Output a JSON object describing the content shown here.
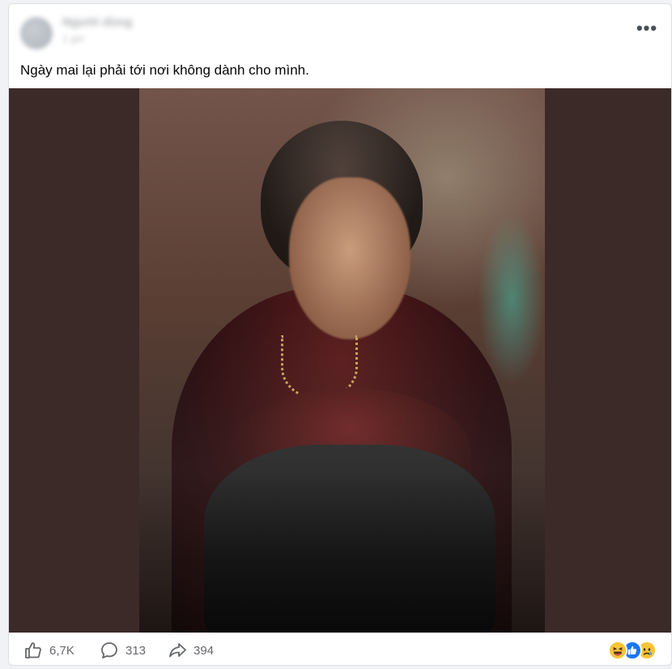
{
  "post": {
    "author_name": "Người dùng",
    "time": "1 giờ",
    "caption": "Ngày mai lại phải tới nơi không dành cho mình."
  },
  "header": {
    "more_label": "•••"
  },
  "stats": {
    "likes": "6,7K",
    "comments": "313",
    "shares": "394"
  },
  "reactions": [
    "haha-icon",
    "like-icon",
    "sad-icon"
  ],
  "colors": {
    "media_background": "#3b2a27",
    "icon_gray": "#65676b",
    "like_blue": "#1877f2",
    "emoji_yellow": "#f7c437"
  }
}
